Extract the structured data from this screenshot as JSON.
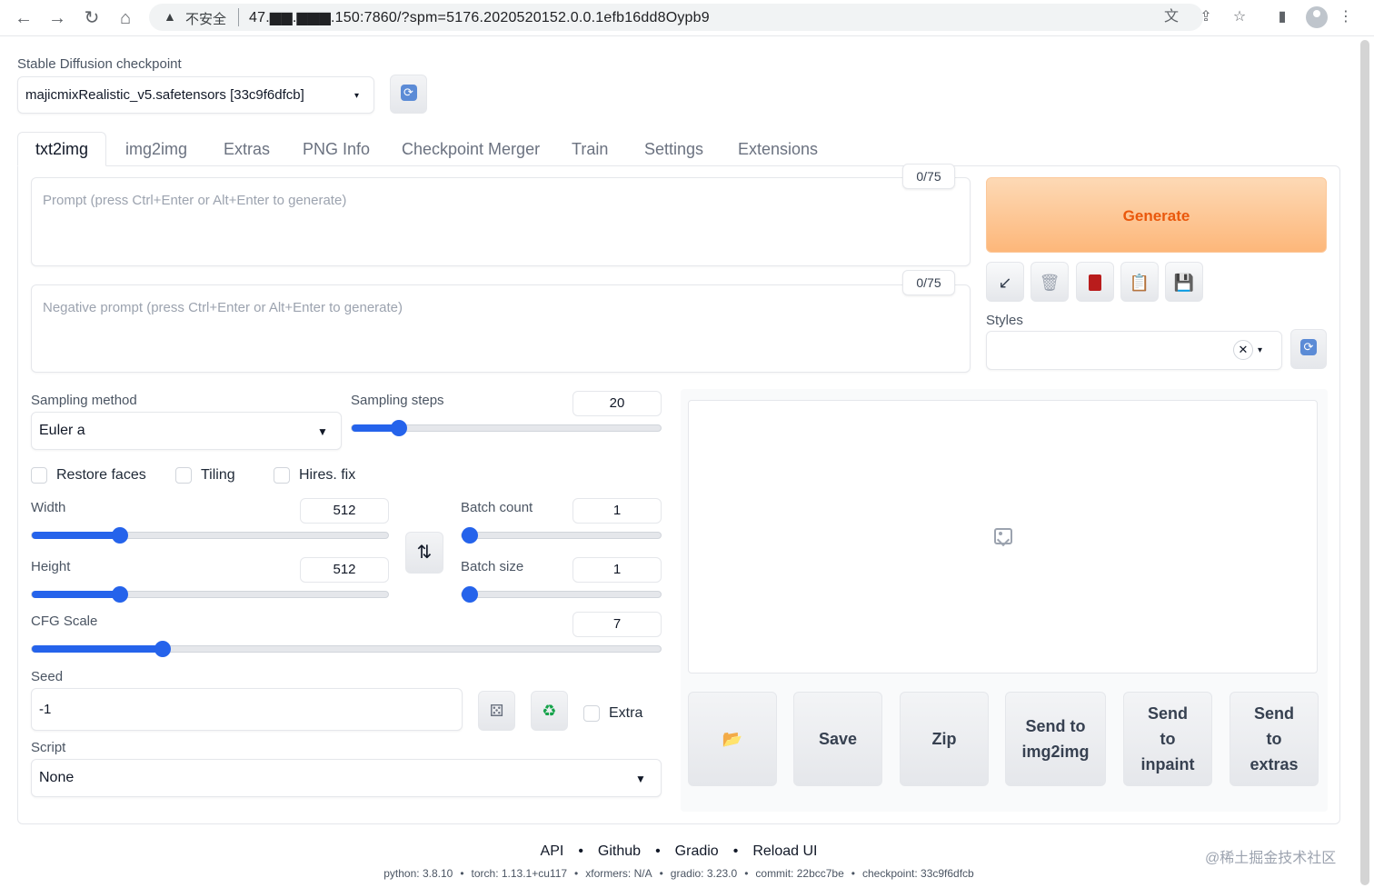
{
  "browser": {
    "back_icon": "←",
    "forward_icon": "→",
    "reload_icon": "↻",
    "home_icon": "⌂",
    "warning_icon": "▲",
    "insecure_label": "不安全",
    "url": "47.▆▆.▆▆▆.150:7860/?spm=5176.2020520152.0.0.1efb16dd8Oypb9"
  },
  "checkpoint": {
    "label": "Stable Diffusion checkpoint",
    "value": "majicmixRealistic_v5.safetensors [33c9f6dfcb]"
  },
  "tabs": [
    "txt2img",
    "img2img",
    "Extras",
    "PNG Info",
    "Checkpoint Merger",
    "Train",
    "Settings",
    "Extensions"
  ],
  "prompt": {
    "placeholder": "Prompt (press Ctrl+Enter or Alt+Enter to generate)",
    "counter": "0/75"
  },
  "negative_prompt": {
    "placeholder": "Negative prompt (press Ctrl+Enter or Alt+Enter to generate)",
    "counter": "0/75"
  },
  "generate_label": "Generate",
  "styles_label": "Styles",
  "sampling_method": {
    "label": "Sampling method",
    "value": "Euler a"
  },
  "sampling_steps": {
    "label": "Sampling steps",
    "value": "20",
    "fraction": 0.133
  },
  "checkboxes": {
    "restore_faces": "Restore faces",
    "tiling": "Tiling",
    "hires_fix": "Hires. fix"
  },
  "width": {
    "label": "Width",
    "value": "512",
    "fraction": 0.234
  },
  "height": {
    "label": "Height",
    "value": "512",
    "fraction": 0.234
  },
  "batch_count": {
    "label": "Batch count",
    "value": "1",
    "fraction": 0.0
  },
  "batch_size": {
    "label": "Batch size",
    "value": "1",
    "fraction": 0.0
  },
  "cfg_scale": {
    "label": "CFG Scale",
    "value": "7",
    "fraction": 0.2
  },
  "seed": {
    "label": "Seed",
    "value": "-1",
    "extra_label": "Extra"
  },
  "script": {
    "label": "Script",
    "value": "None"
  },
  "actions": {
    "folder_icon": "📂",
    "save": "Save",
    "zip": "Zip",
    "send_img2img": "Send to img2img",
    "send_inpaint": "Send to inpaint",
    "send_extras": "Send to extras"
  },
  "footer": {
    "links": [
      "API",
      "Github",
      "Gradio",
      "Reload UI"
    ],
    "info": [
      "python: 3.8.10",
      "torch: 1.13.1+cu117",
      "xformers: N/A",
      "gradio: 3.23.0",
      "commit: 22bcc7be",
      "checkpoint: 33c9f6dfcb"
    ],
    "separator": "•"
  },
  "watermark": "@稀土掘金技术社区",
  "colors": {
    "accent": "#2563eb",
    "generate_text": "#ea580c",
    "generate_bg": "#fdb77a"
  }
}
